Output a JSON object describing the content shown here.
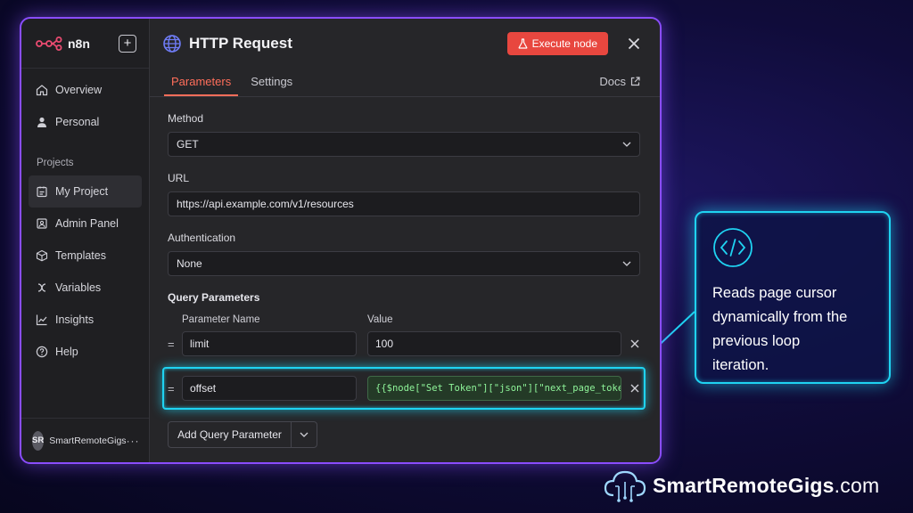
{
  "sidebar": {
    "brand": "n8n",
    "add_label": "+",
    "nav_top": [
      {
        "label": "Overview",
        "icon": "home-icon"
      },
      {
        "label": "Personal",
        "icon": "user-icon"
      }
    ],
    "projects_label": "Projects",
    "nav_projects": [
      {
        "label": "My Project",
        "icon": "project-icon",
        "active": true
      },
      {
        "label": "Admin Panel",
        "icon": "admin-icon"
      },
      {
        "label": "Templates",
        "icon": "box-icon"
      },
      {
        "label": "Variables",
        "icon": "variable-icon"
      },
      {
        "label": "Insights",
        "icon": "chart-icon"
      },
      {
        "label": "Help",
        "icon": "help-icon"
      }
    ],
    "user": {
      "initials": "SR",
      "name": "SmartRemoteGigs",
      "more": "···"
    }
  },
  "header": {
    "title": "HTTP Request",
    "execute_label": "Execute node"
  },
  "tabs": [
    {
      "label": "Parameters",
      "active": true
    },
    {
      "label": "Settings",
      "active": false
    }
  ],
  "docs_label": "Docs",
  "form": {
    "method": {
      "label": "Method",
      "value": "GET"
    },
    "url": {
      "label": "URL",
      "value": "https://api.example.com/v1/resources"
    },
    "auth": {
      "label": "Authentication",
      "value": "None"
    },
    "query": {
      "label": "Query Parameters",
      "col_name": "Parameter Name",
      "col_value": "Value",
      "drag_glyph": "=",
      "rows": [
        {
          "name": "limit",
          "value": "100"
        },
        {
          "name": "offset",
          "value": "{{$node[\"Set Token\"][\"json\"][\"next_page_token\"]}}"
        }
      ],
      "add_label": "Add Query Parameter"
    }
  },
  "callout": {
    "text": "Reads page cursor dynamically from the previous loop iteration."
  },
  "watermark": {
    "bold": "SmartRemoteGigs",
    "suffix": ".com"
  },
  "colors": {
    "accent": "#ff6e5a",
    "execute": "#e8473f",
    "highlight": "#1fd3f2",
    "frame": "#8a4dff",
    "expression": "#8ff59a"
  }
}
